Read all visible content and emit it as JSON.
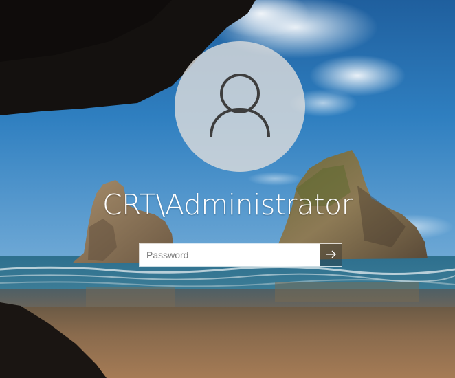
{
  "login": {
    "username": "CRT\\Administrator",
    "password_placeholder": "Password",
    "password_value": ""
  },
  "icons": {
    "avatar": "user-avatar-icon",
    "submit": "arrow-right-icon"
  },
  "colors": {
    "avatar_bg": "#dcdcdc",
    "text": "#ffffff",
    "input_bg": "#ffffff"
  }
}
